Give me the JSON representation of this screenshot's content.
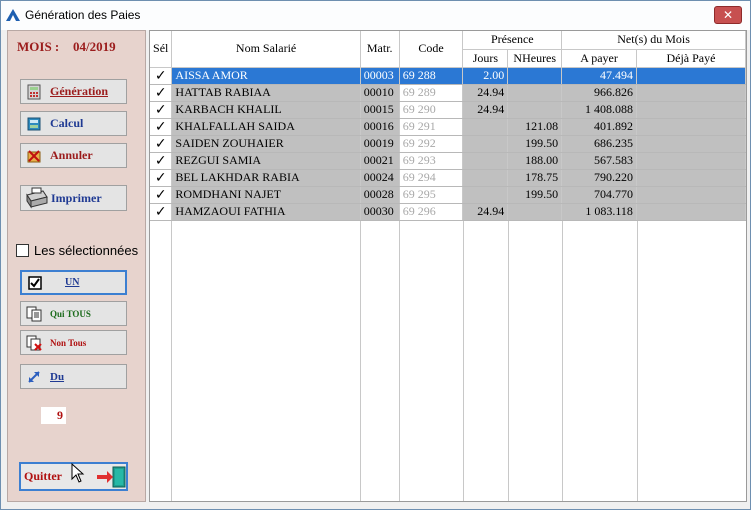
{
  "window": {
    "title": "Génération des Paies",
    "close_label": "✕"
  },
  "left_panel": {
    "mois_label": "MOIS :",
    "mois_value": "04/2019",
    "buttons": {
      "generation": "Génération",
      "calcul": "Calcul",
      "annuler": "Annuler",
      "imprimer": "Imprimer",
      "un": "UN",
      "qui_tous": "Qui TOUS",
      "non_tous": "Non Tous",
      "du": "Du",
      "quitter": "Quitter"
    },
    "selection_checkbox_label": "Les sélectionnées",
    "selected_count": "9"
  },
  "grid": {
    "headers": {
      "sel": "Sél",
      "nom": "Nom Salarié",
      "matr": "Matr.",
      "code": "Code",
      "presence": "Présence",
      "jours": "Jours",
      "nheures": "NHeures",
      "nets": "Net(s) du Mois",
      "a_payer": "A payer",
      "deja_paye": "Déjà Payé"
    },
    "rows": [
      {
        "sel": "✓",
        "nom": "AISSA AMOR",
        "matr": "00003",
        "code": "69 288",
        "jours": "2.00",
        "nheures": "",
        "a_payer": "47.494",
        "deja": ""
      },
      {
        "sel": "✓",
        "nom": "HATTAB RABIAA",
        "matr": "00010",
        "code": "69 289",
        "jours": "24.94",
        "nheures": "",
        "a_payer": "966.826",
        "deja": ""
      },
      {
        "sel": "✓",
        "nom": "KARBACH KHALIL",
        "matr": "00015",
        "code": "69 290",
        "jours": "24.94",
        "nheures": "",
        "a_payer": "1 408.088",
        "deja": ""
      },
      {
        "sel": "✓",
        "nom": "KHALFALLAH SAIDA",
        "matr": "00016",
        "code": "69 291",
        "jours": "",
        "nheures": "121.08",
        "a_payer": "401.892",
        "deja": ""
      },
      {
        "sel": "✓",
        "nom": "SAIDEN ZOUHAIER",
        "matr": "00019",
        "code": "69 292",
        "jours": "",
        "nheures": "199.50",
        "a_payer": "686.235",
        "deja": ""
      },
      {
        "sel": "✓",
        "nom": "REZGUI SAMIA",
        "matr": "00021",
        "code": "69 293",
        "jours": "",
        "nheures": "188.00",
        "a_payer": "567.583",
        "deja": ""
      },
      {
        "sel": "✓",
        "nom": "BEL LAKHDAR RABIA",
        "matr": "00024",
        "code": "69 294",
        "jours": "",
        "nheures": "178.75",
        "a_payer": "790.220",
        "deja": ""
      },
      {
        "sel": "✓",
        "nom": "ROMDHANI NAJET",
        "matr": "00028",
        "code": "69 295",
        "jours": "",
        "nheures": "199.50",
        "a_payer": "704.770",
        "deja": ""
      },
      {
        "sel": "✓",
        "nom": "HAMZAOUI FATHIA",
        "matr": "00030",
        "code": "69 296",
        "jours": "24.94",
        "nheures": "",
        "a_payer": "1 083.118",
        "deja": ""
      }
    ]
  },
  "colors": {
    "accent": "#2b78d4",
    "panel_bg": "#e7d3cd",
    "label_red": "#9b1c1c",
    "label_blue": "#1f3a93"
  },
  "icons": {
    "app": "app-logo-icon",
    "generation": "calculator-icon",
    "calcul": "calculator-icon",
    "annuler": "cancel-icon",
    "imprimer": "printer-icon",
    "un": "checkbox-icon",
    "qui_tous": "copy-pages-icon",
    "non_tous": "delete-pages-icon",
    "du": "resize-arrows-icon",
    "quitter": "exit-door-icon"
  }
}
